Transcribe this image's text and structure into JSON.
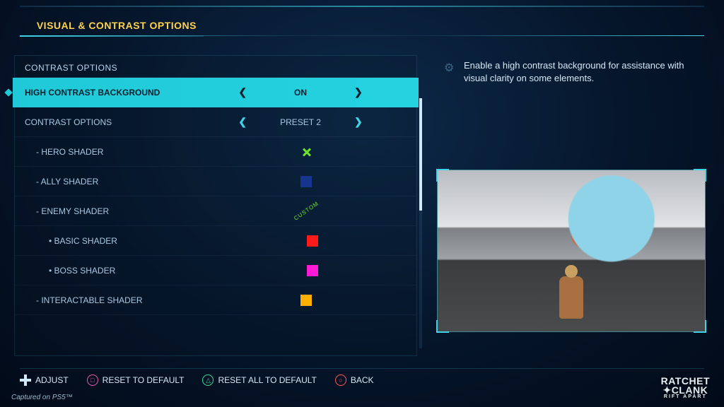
{
  "title": "VISUAL & CONTRAST OPTIONS",
  "section_header": "CONTRAST OPTIONS",
  "description": "Enable a high contrast background for assistance with visual clarity on some elements.",
  "rows": {
    "high_contrast_bg": {
      "label": "HIGH CONTRAST BACKGROUND",
      "value": "ON"
    },
    "contrast_options": {
      "label": "CONTRAST OPTIONS",
      "value": "PRESET 2"
    },
    "hero_shader": {
      "label": "HERO SHADER"
    },
    "ally_shader": {
      "label": "ALLY SHADER",
      "color": "#17358f"
    },
    "enemy_shader": {
      "label": "ENEMY SHADER",
      "tag": "CUSTOM"
    },
    "basic_shader": {
      "label": "BASIC SHADER",
      "color": "#ff1a1a"
    },
    "boss_shader": {
      "label": "BOSS SHADER",
      "color": "#ff1ad6"
    },
    "interactable_shader": {
      "label": "INTERACTABLE SHADER",
      "color": "#ffb000"
    }
  },
  "footer": {
    "adjust": "ADJUST",
    "reset": "RESET TO DEFAULT",
    "reset_all": "RESET ALL TO DEFAULT",
    "back": "BACK"
  },
  "captured": "Captured on PS5™",
  "logo": {
    "line1": "RATCHET",
    "line2": "CLANK",
    "sub": "RIFT APART"
  }
}
